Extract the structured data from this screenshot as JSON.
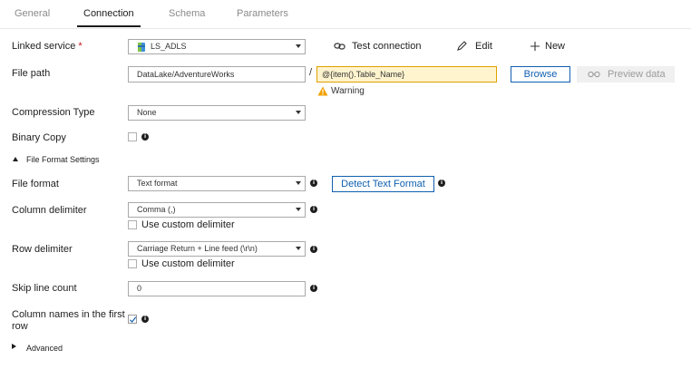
{
  "tabs": [
    {
      "label": "General"
    },
    {
      "label": "Connection"
    },
    {
      "label": "Schema"
    },
    {
      "label": "Parameters"
    }
  ],
  "active_tab": "Connection",
  "linked_service": {
    "label": "Linked service",
    "required_mark": "*",
    "value": "LS_ADLS",
    "actions": {
      "test_connection": "Test connection",
      "edit": "Edit",
      "new": "New"
    }
  },
  "file_path": {
    "label": "File path",
    "folder": "DataLake/AdventureWorks",
    "separator": "/",
    "file": "@{item().Table_Name}",
    "warning": "Warning",
    "browse": "Browse",
    "preview": "Preview data"
  },
  "compression_type": {
    "label": "Compression Type",
    "value": "None"
  },
  "binary_copy": {
    "label": "Binary Copy",
    "checked": false
  },
  "file_format_settings": {
    "label": "File Format Settings",
    "expanded": true,
    "file_format": {
      "label": "File format",
      "value": "Text format",
      "detect_button": "Detect Text Format"
    },
    "column_delimiter": {
      "label": "Column delimiter",
      "value": "Comma (,)",
      "custom_label": "Use custom delimiter",
      "custom_checked": false
    },
    "row_delimiter": {
      "label": "Row delimiter",
      "value": "Carriage Return + Line feed (\\r\\n)",
      "custom_label": "Use custom delimiter",
      "custom_checked": false
    },
    "skip_line_count": {
      "label": "Skip line count",
      "value": "0"
    },
    "column_names_first_row": {
      "label_line1": "Column names in the first",
      "label_line2": "row",
      "checked": true
    }
  },
  "advanced": {
    "label": "Advanced",
    "expanded": false
  },
  "colors": {
    "accent_blue": "#1060b0",
    "highlight_yellow": "#fff4ce",
    "highlight_border": "#e0a000",
    "warning_icon": "#f2a100",
    "disabled_bg": "#f0f0f0",
    "disabled_text": "#9b9b9b"
  },
  "icons": {
    "datastore": "adls-storage-icon",
    "link": "link-icon",
    "edit": "pencil-icon",
    "add": "plus-icon",
    "warning": "warning-icon",
    "preview": "glasses-icon",
    "info": "info-icon",
    "check": "checkmark-icon"
  }
}
